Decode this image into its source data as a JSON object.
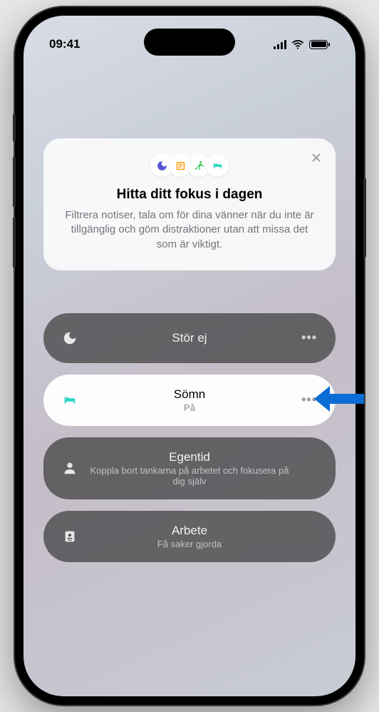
{
  "status": {
    "time": "09:41"
  },
  "card": {
    "title": "Hitta ditt fokus i dagen",
    "desc": "Filtrera notiser, tala om för dina vänner när du inte är tillgänglig och göm distraktioner utan att missa det som är viktigt."
  },
  "focus": {
    "dnd": {
      "label": "Stör ej"
    },
    "sleep": {
      "label": "Sömn",
      "status": "På"
    },
    "personal": {
      "label": "Egentid",
      "desc": "Koppla bort tankarna på arbetet och fokusera på dig själv"
    },
    "work": {
      "label": "Arbete",
      "desc": "Få saker gjorda"
    }
  }
}
